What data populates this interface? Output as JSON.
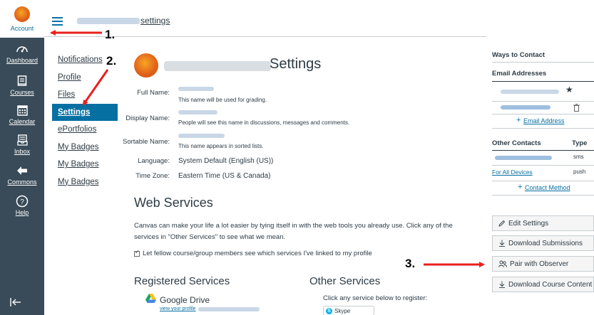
{
  "global_nav": {
    "account": "Account",
    "dashboard": "Dashboard",
    "courses": "Courses",
    "calendar": "Calendar",
    "inbox": "Inbox",
    "commons": "Commons",
    "help": "Help"
  },
  "header": {
    "breadcrumb_suffix": "settings"
  },
  "course_nav": {
    "items": [
      {
        "label": "Notifications"
      },
      {
        "label": "Profile"
      },
      {
        "label": "Files"
      },
      {
        "label": "Settings"
      },
      {
        "label": "ePortfolios"
      },
      {
        "label": "My Badges"
      },
      {
        "label": "My Badges"
      },
      {
        "label": "My Badges"
      }
    ]
  },
  "main": {
    "title": "Settings",
    "fields": {
      "full_name_label": "Full Name:",
      "full_name_help": "This name will be used for grading.",
      "display_name_label": "Display Name:",
      "display_name_help": "People will see this name in discussions, messages and comments.",
      "sortable_name_label": "Sortable Name:",
      "sortable_name_help": "This name appears in sorted lists.",
      "language_label": "Language:",
      "language_value": "System Default (English (US))",
      "timezone_label": "Time Zone:",
      "timezone_value": "Eastern Time (US & Canada)"
    },
    "web_services": {
      "heading": "Web Services",
      "description": "Canvas can make your life a lot easier by tying itself in with the web tools you already use. Click any of the services in \"Other Services\" to see what we mean.",
      "checkbox_label": "Let fellow course/group members see which services I've linked to my profile",
      "registered_heading": "Registered Services",
      "google_drive": "Google Drive",
      "view_profile": "view your profile",
      "other_heading": "Other Services",
      "other_desc": "Click any service below to register:",
      "skype": "Skype"
    }
  },
  "right": {
    "ways_to_contact": "Ways to Contact",
    "email_addresses": "Email Addresses",
    "add_email": "Email Address",
    "other_contacts": "Other Contacts",
    "type": "Type",
    "sms": "sms",
    "for_all_devices": "For All Devices",
    "push": "push",
    "contact_method": "Contact Method",
    "buttons": {
      "edit_settings": "Edit Settings",
      "download_submissions": "Download Submissions",
      "pair_with_observer": "Pair with Observer",
      "download_course_content": "Download Course Content"
    }
  },
  "annotations": {
    "one": "1.",
    "two": "2.",
    "three": "3."
  },
  "colors": {
    "nav_bg": "#394b58",
    "link": "#0770a3",
    "arrow": "#e8201e"
  }
}
